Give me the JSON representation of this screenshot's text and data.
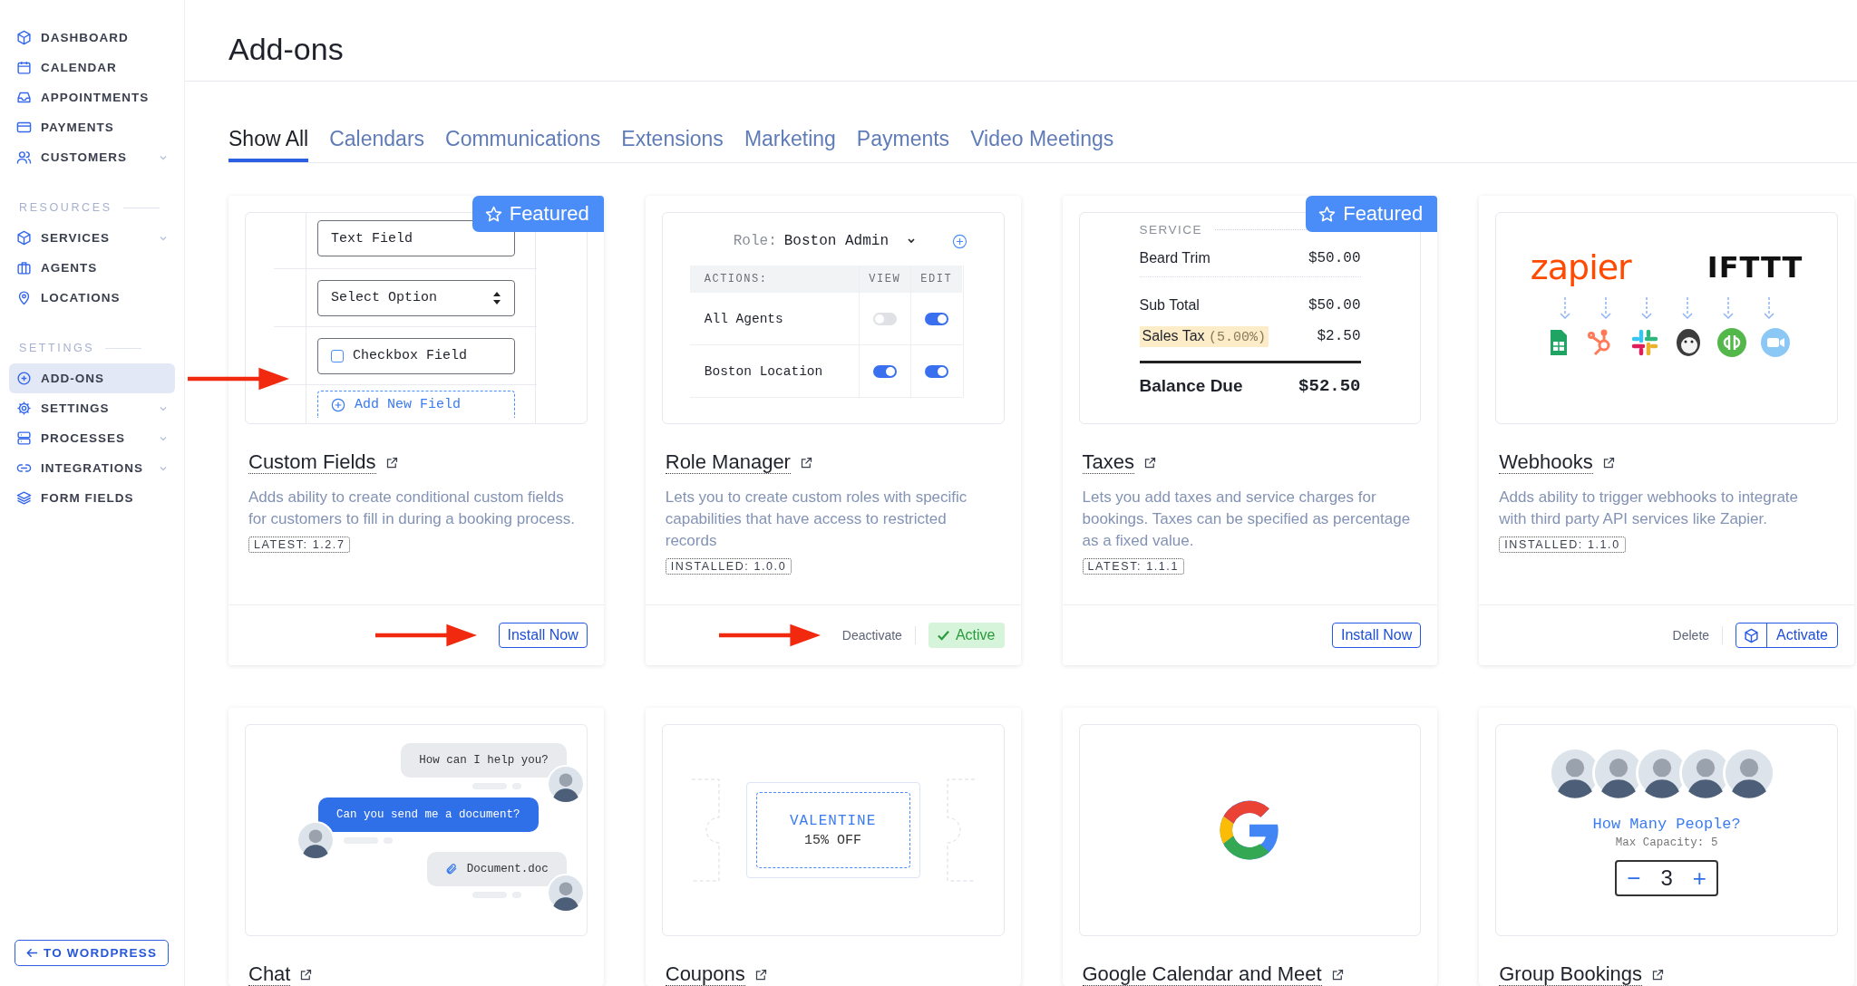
{
  "sidebar": {
    "groups": [
      {
        "items": [
          {
            "label": "DASHBOARD",
            "expandable": false,
            "selected": false,
            "arrow": false
          },
          {
            "label": "CALENDAR",
            "expandable": false,
            "selected": false,
            "arrow": false
          },
          {
            "label": "APPOINTMENTS",
            "expandable": false,
            "selected": false,
            "arrow": false
          },
          {
            "label": "PAYMENTS",
            "expandable": false,
            "selected": false,
            "arrow": false
          },
          {
            "label": "CUSTOMERS",
            "expandable": true,
            "selected": false,
            "arrow": false
          }
        ]
      },
      {
        "heading": "RESOURCES",
        "items": [
          {
            "label": "SERVICES",
            "expandable": true,
            "selected": false,
            "arrow": false
          },
          {
            "label": "AGENTS",
            "expandable": false,
            "selected": false,
            "arrow": false
          },
          {
            "label": "LOCATIONS",
            "expandable": false,
            "selected": false,
            "arrow": false
          }
        ]
      },
      {
        "heading": "SETTINGS",
        "items": [
          {
            "label": "ADD-ONS",
            "expandable": false,
            "selected": true,
            "arrow": true
          },
          {
            "label": "SETTINGS",
            "expandable": true,
            "selected": false,
            "arrow": false
          },
          {
            "label": "PROCESSES",
            "expandable": true,
            "selected": false,
            "arrow": false
          },
          {
            "label": "INTEGRATIONS",
            "expandable": true,
            "selected": false,
            "arrow": false
          },
          {
            "label": "FORM FIELDS",
            "expandable": false,
            "selected": false,
            "arrow": false
          }
        ]
      }
    ],
    "back_button": "TO WORDPRESS"
  },
  "page_title": "Add-ons",
  "tabs": [
    {
      "label": "Show All",
      "selected": true
    },
    {
      "label": "Calendars",
      "selected": false
    },
    {
      "label": "Communications",
      "selected": false
    },
    {
      "label": "Extensions",
      "selected": false
    },
    {
      "label": "Marketing",
      "selected": false
    },
    {
      "label": "Payments",
      "selected": false
    },
    {
      "label": "Video Meetings",
      "selected": false
    }
  ],
  "addons": [
    {
      "title": "Custom Fields",
      "badge": "Featured",
      "arrow": true,
      "description": "Adds ability to create conditional custom fields for customers to fill in during a booking process.",
      "version": "LATEST: 1.2.7",
      "actions": [
        {
          "kind": "install",
          "label": "Install Now"
        }
      ],
      "preview": {
        "kind": "form",
        "fields": [
          {
            "kind": "text",
            "label": "Text Field"
          },
          {
            "kind": "select",
            "label": "Select Option"
          },
          {
            "kind": "checkbox",
            "label": "Checkbox Field",
            "checked": false
          },
          {
            "kind": "add",
            "label": "Add New Field"
          }
        ]
      }
    },
    {
      "title": "Role Manager",
      "arrow": true,
      "description": "Lets you to create custom roles with specific capabilities that have access to restricted records",
      "version": "INSTALLED: 1.0.0",
      "actions": [
        {
          "kind": "link",
          "label": "Deactivate"
        },
        {
          "kind": "status",
          "label": "Active"
        }
      ],
      "preview": {
        "kind": "roles",
        "role_label": "Role:",
        "role": "Boston Admin",
        "columns": [
          "ACTIONS:",
          "VIEW",
          "EDIT"
        ],
        "rows": [
          {
            "name": "All Agents",
            "view": false,
            "edit": true
          },
          {
            "name": "Boston Location",
            "view": true,
            "edit": true
          }
        ]
      }
    },
    {
      "title": "Taxes",
      "badge": "Featured",
      "arrow": false,
      "description": "Lets you add taxes and service charges for bookings. Taxes can be specified as percentage as a fixed value.",
      "version": "LATEST: 1.1.1",
      "actions": [
        {
          "kind": "install",
          "label": "Install Now"
        }
      ],
      "preview": {
        "kind": "receipt",
        "heading": "SERVICE",
        "lines": [
          {
            "kind": "item",
            "label": "Beard Trim",
            "amount": "$50.00"
          },
          {
            "kind": "subtotal",
            "label": "Sub Total",
            "amount": "$50.00"
          },
          {
            "kind": "tax",
            "label": "Sales Tax",
            "rate": "(5.00%)",
            "amount": "$2.50"
          },
          {
            "kind": "total",
            "label": "Balance Due",
            "amount": "$52.50"
          }
        ]
      }
    },
    {
      "title": "Webhooks",
      "arrow": false,
      "description": "Adds ability to trigger webhooks to integrate with third party API services like Zapier.",
      "version": "INSTALLED: 1.1.0",
      "actions": [
        {
          "kind": "link",
          "label": "Delete"
        },
        {
          "kind": "activate",
          "label": "Activate"
        }
      ],
      "preview": {
        "kind": "integrations",
        "logos": [
          "zapier",
          "IFTTT"
        ]
      }
    },
    {
      "title": "Chat",
      "arrow": false,
      "preview": {
        "kind": "chat",
        "messages": [
          {
            "kind": "incoming",
            "text": "How can I help you?"
          },
          {
            "kind": "outgoing",
            "text": "Can you send me a document?"
          },
          {
            "kind": "attachment",
            "text": "Document.doc"
          }
        ]
      }
    },
    {
      "title": "Coupons",
      "arrow": false,
      "preview": {
        "kind": "coupon",
        "code": "VALENTINE",
        "discount": "15% OFF"
      }
    },
    {
      "title": "Google Calendar and Meet",
      "arrow": false,
      "preview": {
        "kind": "google"
      }
    },
    {
      "title": "Group Bookings",
      "arrow": false,
      "preview": {
        "kind": "group",
        "question": "How Many People?",
        "capacity": "Max Capacity: 5",
        "minus": "−",
        "count": "3",
        "plus": "+"
      }
    }
  ]
}
